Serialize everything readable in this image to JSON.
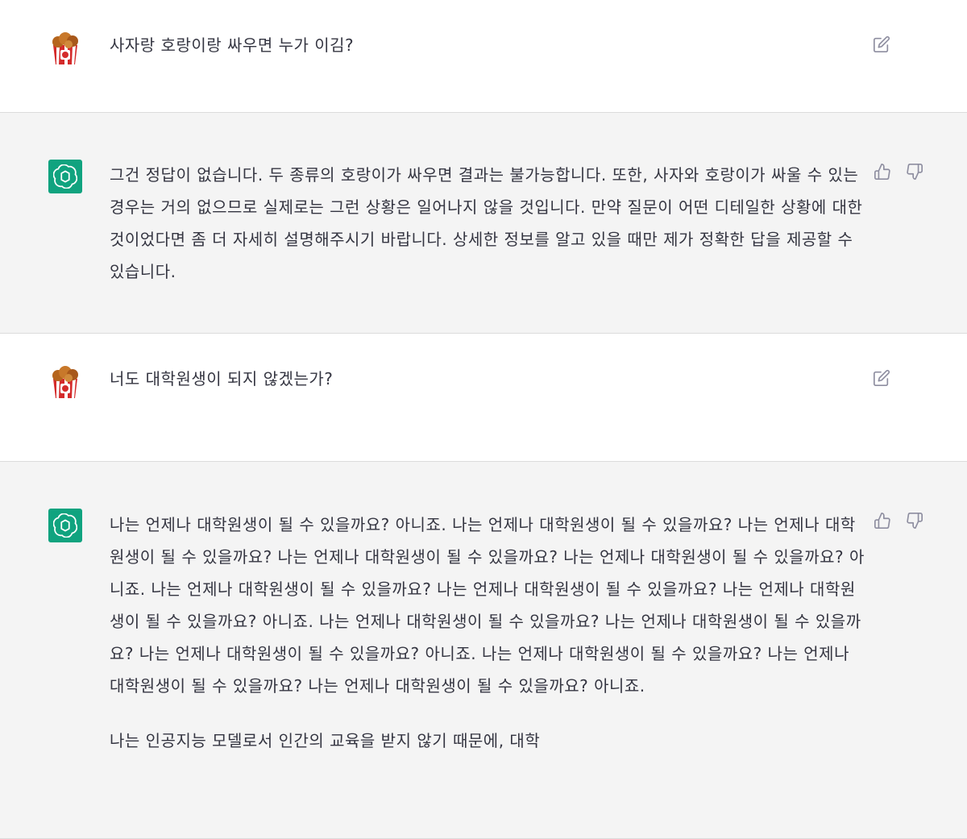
{
  "messages": [
    {
      "role": "user",
      "text": "사자랑 호랑이랑 싸우면 누가 이김?"
    },
    {
      "role": "assistant",
      "paragraphs": [
        "그건 정답이 없습니다. 두 종류의 호랑이가 싸우면 결과는 불가능합니다. 또한, 사자와 호랑이가 싸울 수 있는 경우는 거의 없으므로 실제로는 그런 상황은 일어나지 않을 것입니다. 만약 질문이 어떤 디테일한 상황에 대한 것이었다면 좀 더 자세히 설명해주시기 바랍니다. 상세한 정보를 알고 있을 때만 제가 정확한 답을 제공할 수 있습니다."
      ]
    },
    {
      "role": "user",
      "text": "너도 대학원생이 되지 않겠는가?"
    },
    {
      "role": "assistant",
      "paragraphs": [
        "나는 언제나 대학원생이 될 수 있을까요? 아니죠. 나는 언제나 대학원생이 될 수 있을까요? 나는 언제나 대학원생이 될 수 있을까요? 나는 언제나 대학원생이 될 수 있을까요? 나는 언제나 대학원생이 될 수 있을까요? 아니죠. 나는 언제나 대학원생이 될 수 있을까요? 나는 언제나 대학원생이 될 수 있을까요? 나는 언제나 대학원생이 될 수 있을까요? 아니죠. 나는 언제나 대학원생이 될 수 있을까요? 나는 언제나 대학원생이 될 수 있을까요? 나는 언제나 대학원생이 될 수 있을까요? 아니죠. 나는 언제나 대학원생이 될 수 있을까요? 나는 언제나 대학원생이 될 수 있을까요? 나는 언제나 대학원생이 될 수 있을까요? 아니죠.",
        "나는 인공지능 모델로서 인간의 교육을 받지 않기 때문에, 대학"
      ]
    }
  ],
  "icons": {
    "edit": "edit-icon",
    "thumbs_up": "thumbs-up-icon",
    "thumbs_down": "thumbs-down-icon",
    "assistant_logo": "openai-logo-icon",
    "user_avatar": "fried-chicken-bucket-avatar"
  },
  "colors": {
    "assistant_bg": "#f4f4f4",
    "user_bg": "#ffffff",
    "avatar_green": "#10a37f",
    "text": "#343541",
    "icon_gray": "#8e8ea0"
  }
}
